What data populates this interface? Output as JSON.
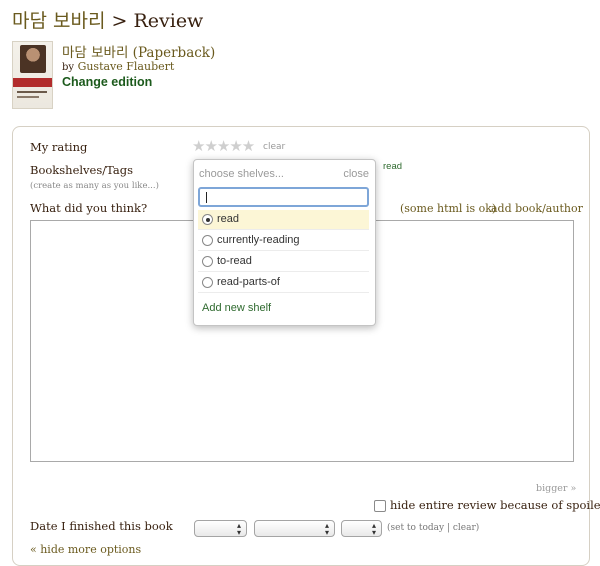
{
  "header": {
    "book_title_korean": "마담 보바리",
    "separator_review": " > Review"
  },
  "book": {
    "title": "마담 보바리 (Paperback)",
    "by": "by",
    "author": "Gustave Flaubert",
    "change_edition": "Change edition"
  },
  "form": {
    "my_rating_label": "My rating",
    "rating_stars": "★★★★★",
    "rating_value": 0,
    "clear_label": "clear",
    "shelves_label": "Bookshelves/Tags",
    "shelves_hint": "(create as many as you like...)",
    "current_shelf": "read",
    "review_label": "What did you think?",
    "html_note": "(some html is ok)",
    "add_book_author": "add book/author",
    "review_text": "",
    "bigger_label": "bigger »",
    "hide_spoilers_label": "hide entire review because of spoilers",
    "hide_spoilers_checked": false,
    "date_label": "Date I finished this book",
    "date_selects": [
      "",
      "",
      ""
    ],
    "set_today": "(set to today | clear)",
    "hide_more_options": "« hide more options"
  },
  "shelf_popup": {
    "header": "choose shelves...",
    "close": "close",
    "filter_value": "",
    "shelves": [
      {
        "label": "read",
        "selected": true
      },
      {
        "label": "currently-reading",
        "selected": false
      },
      {
        "label": "to-read",
        "selected": false
      },
      {
        "label": "read-parts-of",
        "selected": false
      }
    ],
    "add_new_shelf": "Add new shelf"
  },
  "colors": {
    "brown_text": "#382110",
    "link_olive": "#6a5a1e",
    "link_green": "#1c5a1c",
    "selected_row": "#fcf6d6",
    "focus_border": "#7ea6d8"
  }
}
